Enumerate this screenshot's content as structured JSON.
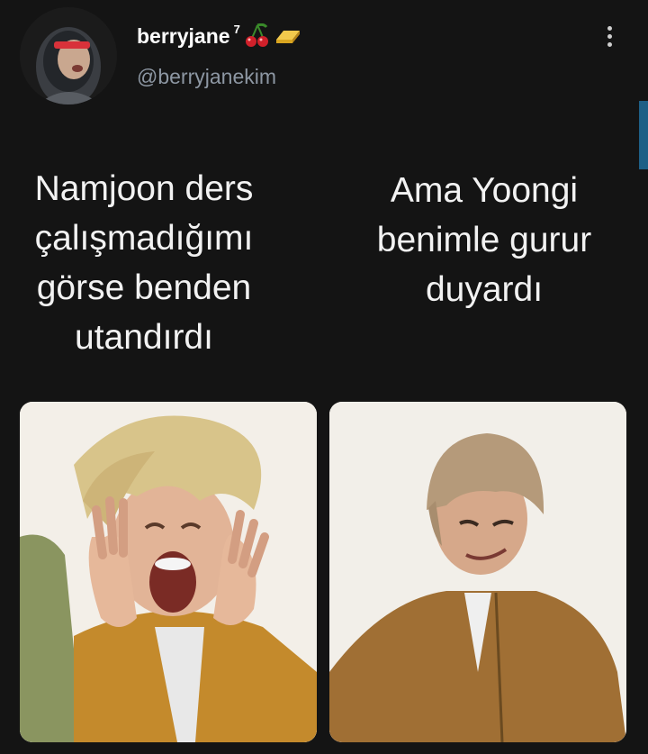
{
  "tweet": {
    "author": {
      "display_name": "berryjane",
      "superscript": "7",
      "emoji_badges": [
        "cherries-emoji",
        "gold-bar-emoji"
      ],
      "handle": "@berryjanekim"
    },
    "menu_icon": "more-vertical-icon",
    "captions": {
      "left": [
        "Namjoon ders",
        "çalışmadığımı",
        "görse benden",
        "utandırdı"
      ],
      "right": [
        "Ama Yoongi",
        "benimle gurur",
        "duyardı"
      ]
    },
    "images": [
      {
        "name": "screaming-face-photo"
      },
      {
        "name": "smirking-face-photo"
      }
    ]
  },
  "colors": {
    "background": "#141414",
    "handle": "#8d97a3",
    "text": "#ffffff"
  }
}
